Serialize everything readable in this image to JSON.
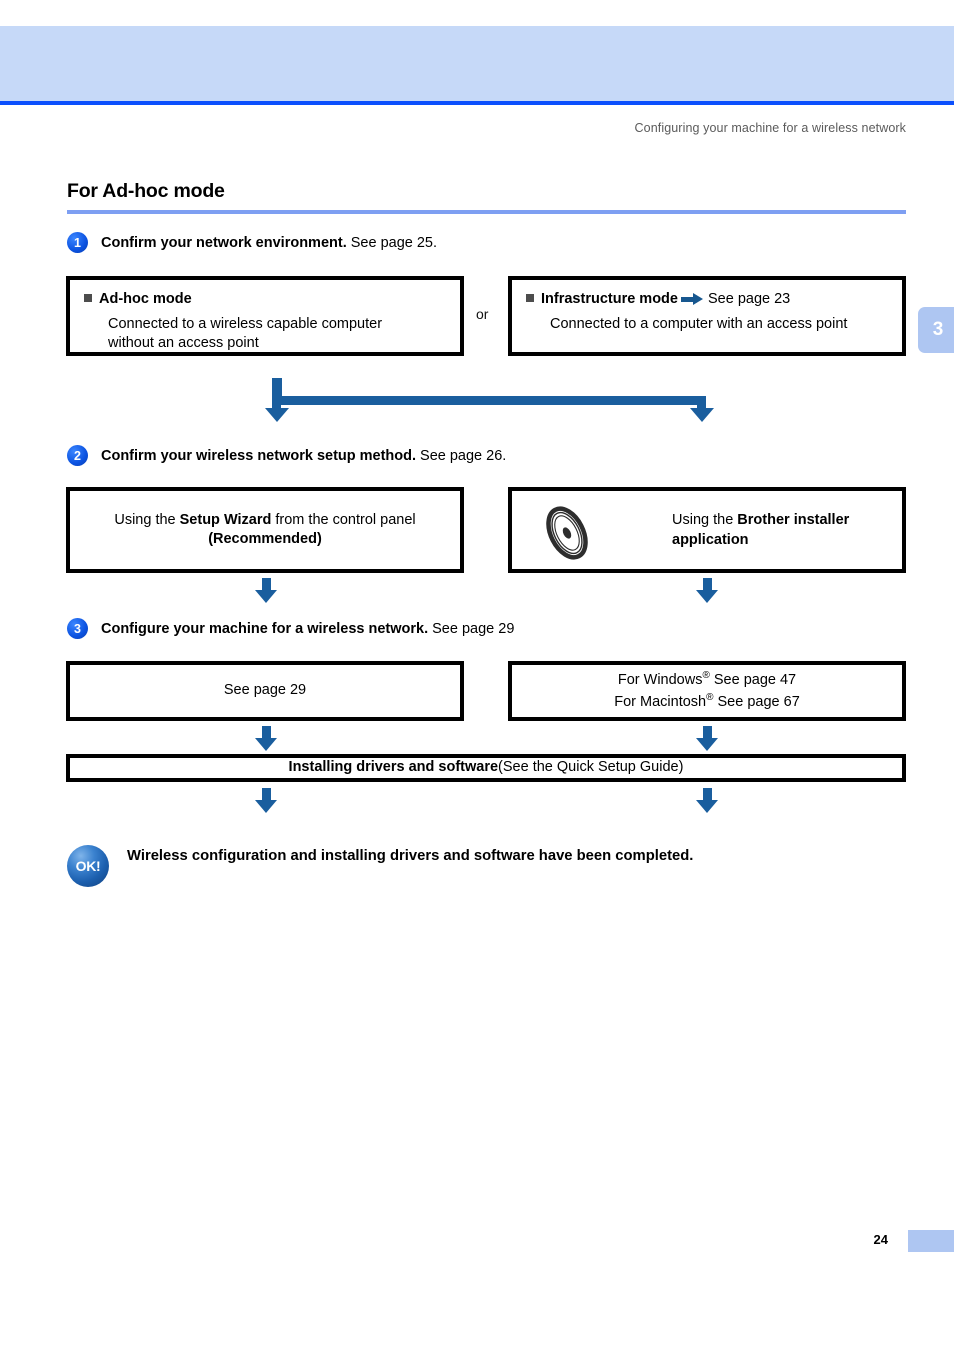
{
  "page": {
    "running_head": "Configuring your machine for a wireless network",
    "chapter_tab": "3",
    "page_number": "24",
    "section_title": "For Ad-hoc mode"
  },
  "steps": [
    {
      "number": "1",
      "bold": "Confirm your network environment.",
      "rest": "See page 25."
    },
    {
      "number": "2",
      "bold": "Confirm your wireless network setup method.",
      "rest": "See page 26."
    },
    {
      "number": "3",
      "bold": "Configure your machine for a wireless network.",
      "rest": "See page 29"
    }
  ],
  "row1": {
    "left_box": {
      "heading": "Ad-hoc mode",
      "body_line1": "Connected to a wireless capable computer",
      "body_line2": "without an access point"
    },
    "or_label": "or",
    "right_box": {
      "heading": "Infrastructure mode",
      "heading_link": "See page 23",
      "body": "Connected to a computer with an access point"
    }
  },
  "row2": {
    "left_box": {
      "line1_prefix": "Using the ",
      "line1_bold": "Setup Wizard",
      "line1_suffix": " from the control panel",
      "line2_bold": "(Recommended)"
    },
    "right_box": {
      "icon": "cd-disc-icon",
      "line1_prefix": "Using the ",
      "line1_bold": "Brother installer",
      "line2_bold": "application"
    }
  },
  "row3": {
    "left_box": {
      "text": "See page 29"
    },
    "right_box": {
      "line1": "For Windows",
      "line1_sup": "®",
      "line1_tail": " See page 47",
      "line2": "For Macintosh",
      "line2_sup": "®",
      "line2_tail": " See page 67"
    }
  },
  "install_bar": {
    "bold": "Installing drivers and software",
    "rest": " (See the Quick Setup Guide)"
  },
  "completion": {
    "badge": "OK!",
    "text": "Wireless configuration and installing drivers and software have been completed."
  },
  "colors": {
    "header_band": "#c6d9f8",
    "header_rule": "#0b4ffd",
    "title_rule": "#7e9ff2",
    "arrow_blue": "#1a5e9e",
    "tab_blue": "#aec6f2",
    "step_badge_blue": "#0b52e0"
  }
}
